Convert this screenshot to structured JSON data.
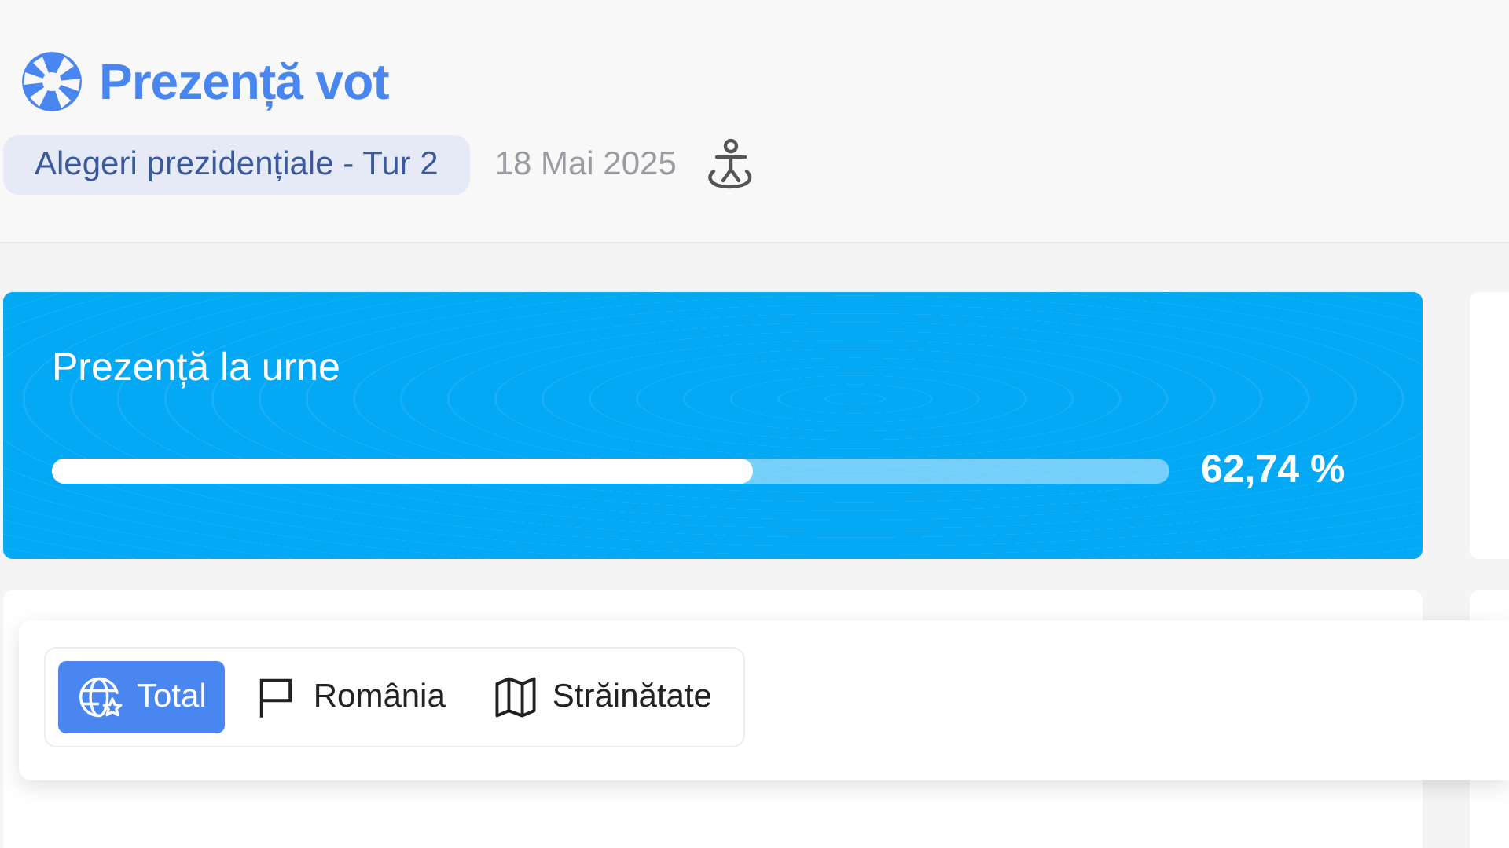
{
  "header": {
    "title": "Prezență vot",
    "election_tag": "Alegeri prezidențiale - Tur 2",
    "date": "18 Mai 2025"
  },
  "turnout_card": {
    "title": "Prezență la urne",
    "level": 0.6274,
    "reading": "62,74 %"
  },
  "filter_tabs": [
    {
      "label": "Total",
      "selected": true
    },
    {
      "label": "România",
      "selected": false
    },
    {
      "label": "Străinătate",
      "selected": false
    }
  ]
}
